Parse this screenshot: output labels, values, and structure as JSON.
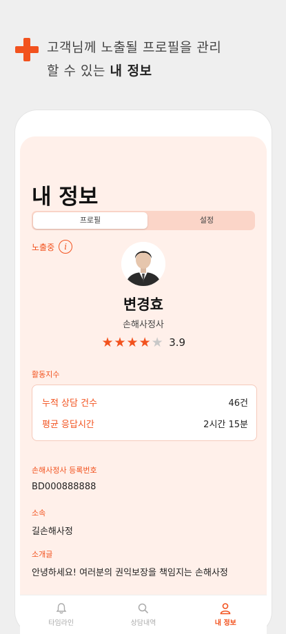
{
  "promo": {
    "line1": "고객님께 노출될 프로필을 관리",
    "line2_prefix": "할 수 있는 ",
    "line2_bold": "내 정보"
  },
  "page": {
    "title": "내 정보"
  },
  "segment": {
    "tabs": [
      "프로필",
      "설정"
    ],
    "active_index": 0
  },
  "profile": {
    "status": "노출중",
    "name": "변경효",
    "role": "손해사정사",
    "rating": 3.9,
    "rating_text": "3.9",
    "stars_filled": 4,
    "stars_total": 5
  },
  "activity": {
    "label": "활동지수",
    "rows": [
      {
        "key": "누적 상담 건수",
        "value": "46건"
      },
      {
        "key": "평균 응답시간",
        "value": "2시간 15분"
      }
    ]
  },
  "registration": {
    "label": "손해사정사 등록번호",
    "value": "BD000888888"
  },
  "affiliation": {
    "label": "소속",
    "value": "길손해사정"
  },
  "intro": {
    "label": "소개글",
    "value": "안녕하세요! 여러분의 권익보장을 책임지는 손해사정"
  },
  "tabbar": {
    "items": [
      {
        "label": "타임라인",
        "icon": "bell-icon"
      },
      {
        "label": "상담내역",
        "icon": "search-icon"
      },
      {
        "label": "내 정보",
        "icon": "person-icon"
      }
    ],
    "active_index": 2
  },
  "colors": {
    "accent": "#f2521e",
    "screen_bg": "#fff0ea",
    "page_bg": "#efefef"
  }
}
